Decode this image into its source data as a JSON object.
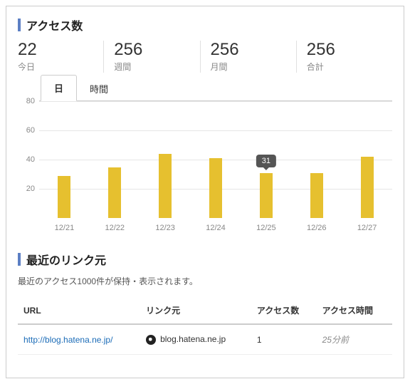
{
  "section_access_title": "アクセス数",
  "stats": {
    "today": {
      "value": "22",
      "label": "今日"
    },
    "week": {
      "value": "256",
      "label": "週間"
    },
    "month": {
      "value": "256",
      "label": "月間"
    },
    "total": {
      "value": "256",
      "label": "合計"
    }
  },
  "tabs": {
    "day": "日",
    "hour": "時間"
  },
  "chart_data": {
    "type": "bar",
    "categories": [
      "12/21",
      "12/22",
      "12/23",
      "12/24",
      "12/25",
      "12/26",
      "12/27"
    ],
    "values": [
      29,
      35,
      44,
      41,
      31,
      31,
      42
    ],
    "ylim": [
      0,
      80
    ],
    "yticks": [
      20,
      40,
      60,
      80
    ],
    "highlight_index": 4,
    "highlight_label": "31",
    "xlabel": "",
    "ylabel": "",
    "title": ""
  },
  "section_links_title": "最近のリンク元",
  "links_subtitle": "最近のアクセス1000件が保持・表示されます。",
  "links_table": {
    "headers": {
      "url": "URL",
      "referrer": "リンク元",
      "count": "アクセス数",
      "time": "アクセス時間"
    },
    "rows": [
      {
        "url": "http://blog.hatena.ne.jp/",
        "referrer": "blog.hatena.ne.jp",
        "count": "1",
        "time": "25分前"
      }
    ]
  }
}
